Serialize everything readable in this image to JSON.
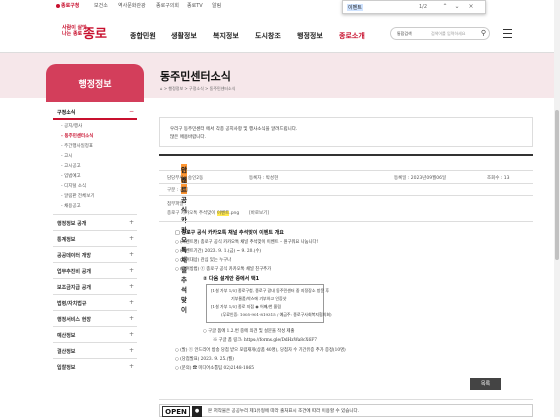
{
  "topbar": {
    "home": "종로구청",
    "links": [
      "보건소",
      "역사문화관광",
      "종로구의회",
      "종로TV",
      "알림"
    ]
  },
  "find": {
    "query": "이벤트",
    "count": "1/2",
    "prev_icon": "chevron-up-icon",
    "next_icon": "chevron-down-icon",
    "close_icon": "close-icon"
  },
  "logo": {
    "line1": "사람이 살맛",
    "line2": "나는 종로",
    "mark": "종로"
  },
  "gnb": [
    "종합민원",
    "생활정보",
    "복지정보",
    "도시창조",
    "행정정보",
    "종로소개"
  ],
  "search": {
    "scope": "통합검색",
    "placeholder": "검색어를 입력하세요",
    "icon": "search-icon"
  },
  "band": {
    "title": "동주민센터소식",
    "breadcrumb": "⌂ > 행정정보 > 구정소식 > 동주민센터소식"
  },
  "sidebar": {
    "title": "행정정보",
    "current": "구정소식",
    "submenu": [
      "공지/행사",
      "동주민센터소식",
      "주간행사일정표",
      "고시",
      "고시공고",
      "입법예고",
      "디지털 소식",
      "알림판 전체보기",
      "채용공고"
    ],
    "active_sub": "동주민센터소식",
    "sections": [
      "행정정보 공개",
      "통계정보",
      "공공데이터 개방",
      "업무추진비 공개",
      "보조금지급 공개",
      "법령/자치법규",
      "행정서비스 현장",
      "예산정보",
      "결산정보",
      "입찰정보"
    ]
  },
  "intro": {
    "line1": "우리구 동주민센터 에서 각종 공지사항 및 행사소식을 알려드립니다.",
    "line2": "많은 애용바랍니다."
  },
  "post": {
    "title_pre": "종로구 공식 카카오톡 채널 추석맞이 ",
    "title_hl": "이벤트",
    "title_post": " 안내",
    "dept_label": "담당부서 : 숭인2동",
    "writer_label": "등록자 : 박성현",
    "date_label": "등록일 : 2023년09월06일",
    "views_label": "조회수 : 13",
    "category": "구분 : 공지",
    "attach_label": "첨부파일 :",
    "file_pre": "종로구 카카오톡 추석맞이 ",
    "file_hl": "이벤트",
    "file_post": ".png",
    "preview": "[바로보기]"
  },
  "body": {
    "heading": "□ 종로구 공식 카카오톡 채널 추석맞이 이벤트 개요",
    "lines": [
      "○ (이벤트명) 종로구 공식 카카오톡 채널 추석맞이 이벤트 – 원구워요 나눕니다!",
      "○ (이벤트기간) 2023. 9. 1.(금) ~ 9. 20.(수)",
      "○ (참여대상) 관심 있는 누구나",
      "○ (참여방법) ① 종로구 공식 카카오톡 채널 친구추가",
      "② 다음 설게안 중에서 택1",
      "○ 구글 폼에 1.2.번 중에 의견 및 설문을 작성 제출",
      "※ 구글 폼 링크: https://forms.gle/DdHzWa8cX6F7",
      "○ (발) ① 안드리어 방송 당첨 받으 포럼재개(상품 40명), 당첨자 수 기간유증 추가 증정(10명)",
      "○ (당첨발표) 2023. 9. 25.(월)",
      "○ (문의) ☎ 미디어소통팀 02)2148-1865"
    ],
    "box_lines": [
      "[1설 가부 1/5] 종로구청, 종로구 광내 동주민센터 중 지정장소 방문 후",
      "기부물품/박스에 기부하고 인증샷",
      "[1설 가부 1/5] 종로 지점 ◉ 어째/천 올림",
      "(무료인증: 1005-901-819315 / 예금주: 종로구사회복지협의회)"
    ]
  },
  "list_button": "목록",
  "kogl": {
    "badge": "OPEN",
    "text": "본 저작물은 공공누리 제1유형에 따라 출처표시 조건에 따라 이용할 수 있습니다."
  }
}
